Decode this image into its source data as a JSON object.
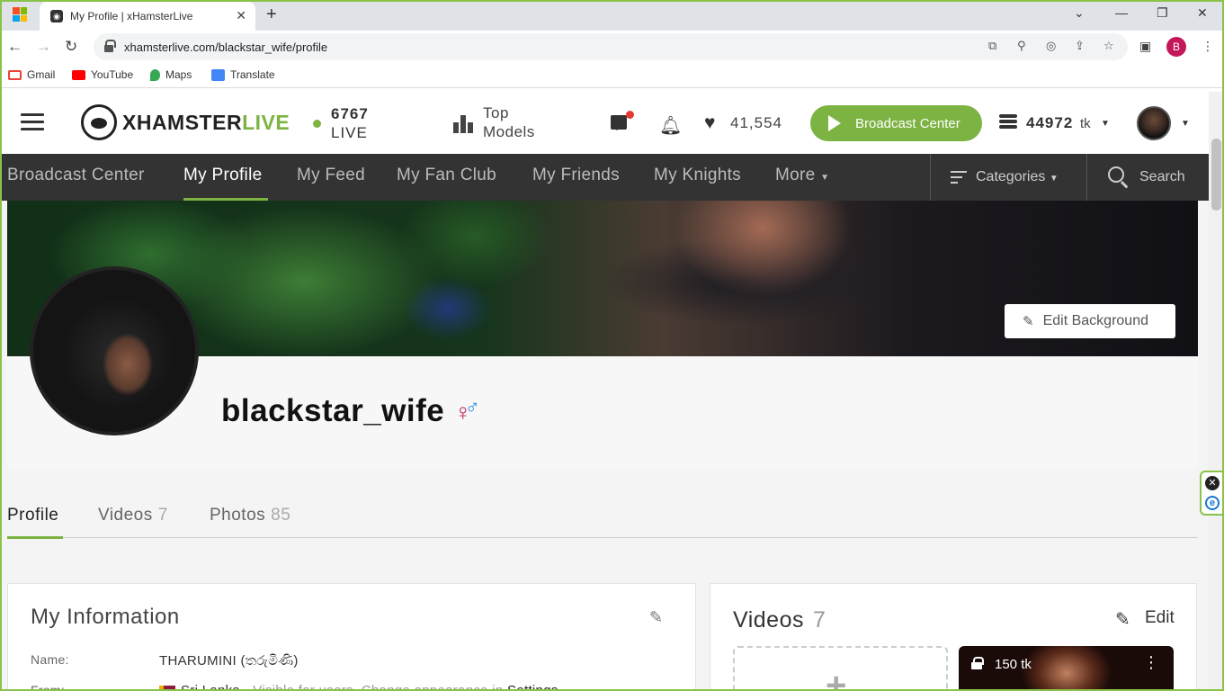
{
  "browser": {
    "tab_title": "My Profile | xHamsterLive",
    "url": "xhamsterlive.com/blackstar_wife/profile",
    "profile_initial": "B",
    "bookmarks": [
      "Gmail",
      "YouTube",
      "Maps",
      "Translate"
    ]
  },
  "header": {
    "logo_x": "XHAMSTER",
    "logo_live": "LIVE",
    "live_count": "6767",
    "live_label": "LIVE",
    "top_models_line1": "Top",
    "top_models_line2": "Models",
    "favorites_count": "41,554",
    "broadcast_button": "Broadcast Center",
    "tokens": "44972",
    "tokens_unit": "tk"
  },
  "nav": {
    "items": [
      "Broadcast Center",
      "My Profile",
      "My Feed",
      "My Fan Club",
      "My Friends",
      "My Knights",
      "More"
    ],
    "active": "My Profile",
    "categories": "Categories",
    "search": "Search"
  },
  "profile": {
    "edit_background": "Edit Background",
    "username": "blackstar_wife",
    "tabs": [
      {
        "label": "Profile",
        "count": ""
      },
      {
        "label": "Videos",
        "count": "7"
      },
      {
        "label": "Photos",
        "count": "85"
      }
    ]
  },
  "info": {
    "title": "My Information",
    "name_label": "Name:",
    "name_value": "THARUMINI (තරුමිණි)",
    "from_label": "From:",
    "from_country": "Sri Lanka",
    "from_note": "· Visible for users. Change appearance in",
    "from_settings": "Settings"
  },
  "videos": {
    "title": "Videos",
    "count": "7",
    "edit": "Edit",
    "thumb_price": "150 tk"
  },
  "colors": {
    "accent": "#7cb342",
    "nav_bg": "#333333"
  }
}
